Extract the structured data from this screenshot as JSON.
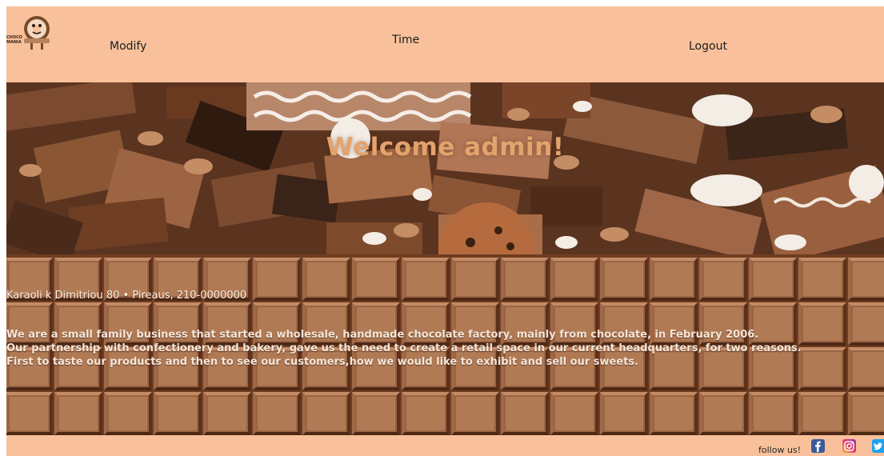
{
  "header": {
    "logo_text": "CHOCO MANIA",
    "nav": {
      "modify": "Modify",
      "time": "Time",
      "logout": "Logout"
    }
  },
  "hero": {
    "title": "Welcome admin!"
  },
  "info": {
    "address": "Karaoli k Dimitriou 80 • Pireaus, 210-0000000",
    "about_lines": [
      "We are a small family business that started a wholesale, handmade chocolate factory, mainly from chocolate, in February 2006.",
      "Our partnership with confectionery and bakery, gave us the need to create a retail space in our current headquarters, for two reasons.",
      "First to taste our products and then to see our customers,how we would like to exhibit and sell our sweets."
    ]
  },
  "footer": {
    "follow_label": "follow us!",
    "social": [
      "facebook-icon",
      "instagram-icon",
      "twitter-icon"
    ]
  },
  "colors": {
    "header_bg": "#f8c19b",
    "hero_title": "#e3a36d",
    "chocolate_dark": "#6f3d21",
    "chocolate_tile": "#b07a55"
  }
}
